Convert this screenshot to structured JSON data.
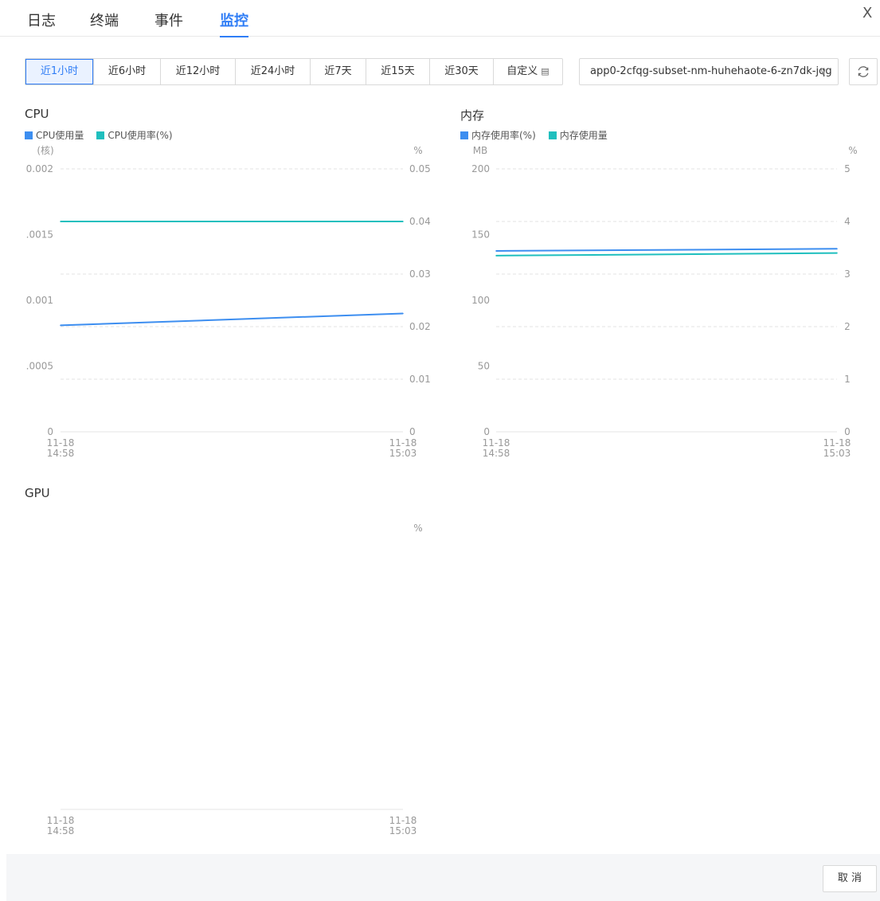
{
  "tabs": [
    {
      "label": "日志",
      "active": false
    },
    {
      "label": "终端",
      "active": false
    },
    {
      "label": "事件",
      "active": false
    },
    {
      "label": "监控",
      "active": true
    }
  ],
  "close_label": "X",
  "time_ranges": [
    {
      "label": "近1小时",
      "active": true
    },
    {
      "label": "近6小时",
      "active": false
    },
    {
      "label": "近12小时",
      "active": false
    },
    {
      "label": "近24小时",
      "active": false
    },
    {
      "label": "近7天",
      "active": false
    },
    {
      "label": "近15天",
      "active": false
    },
    {
      "label": "近30天",
      "active": false
    },
    {
      "label": "自定义",
      "active": false
    }
  ],
  "pod_select": {
    "value": "app0-2cfqg-subset-nm-huhehaote-6-zn7dk-jqg"
  },
  "colors": {
    "accent": "#2f7df6",
    "series_blue": "#3d8ef0",
    "series_teal": "#1fbfbe"
  },
  "footer": {
    "cancel_label": "取 消"
  },
  "chart_data": [
    {
      "type": "line",
      "title": "CPU",
      "left_unit": "(核)",
      "right_unit": "%",
      "left_ticks": [
        "0",
        ".0005",
        "0.001",
        ".0015",
        "0.002"
      ],
      "right_ticks": [
        "0",
        "0.01",
        "0.02",
        "0.03",
        "0.04",
        "0.05"
      ],
      "left_ylim": [
        0,
        0.002
      ],
      "right_ylim": [
        0,
        0.05
      ],
      "x_ticks": [
        [
          "11-18",
          "14:58"
        ],
        [
          "11-18",
          "15:03"
        ]
      ],
      "grid": true,
      "series": [
        {
          "name": "CPU使用量",
          "axis": "left",
          "color": "#3d8ef0",
          "x": [
            "14:58",
            "15:03"
          ],
          "values": [
            0.00081,
            0.0009
          ]
        },
        {
          "name": "CPU使用率(%)",
          "axis": "right",
          "color": "#1fbfbe",
          "x": [
            "14:58",
            "15:03"
          ],
          "values": [
            0.04,
            0.04
          ]
        }
      ]
    },
    {
      "type": "line",
      "title": "内存",
      "left_unit": "MB",
      "right_unit": "%",
      "left_ticks": [
        "0",
        "50",
        "100",
        "150",
        "200"
      ],
      "right_ticks": [
        "0",
        "1",
        "2",
        "3",
        "4",
        "5"
      ],
      "left_ylim": [
        0,
        200
      ],
      "right_ylim": [
        0,
        5
      ],
      "x_ticks": [
        [
          "11-18",
          "14:58"
        ],
        [
          "11-18",
          "15:03"
        ]
      ],
      "grid": true,
      "series": [
        {
          "name": "内存使用率(%)",
          "axis": "right",
          "color": "#3d8ef0",
          "x": [
            "14:58",
            "15:03"
          ],
          "values": [
            3.44,
            3.48
          ]
        },
        {
          "name": "内存使用量",
          "axis": "left",
          "color": "#1fbfbe",
          "x": [
            "14:58",
            "15:03"
          ],
          "values": [
            134,
            136
          ]
        }
      ]
    },
    {
      "type": "line",
      "title": "GPU",
      "left_unit": "",
      "right_unit": "%",
      "left_ticks": [],
      "right_ticks": [],
      "x_ticks": [
        [
          "11-18",
          "14:58"
        ],
        [
          "11-18",
          "15:03"
        ]
      ],
      "grid": false,
      "series": []
    }
  ]
}
